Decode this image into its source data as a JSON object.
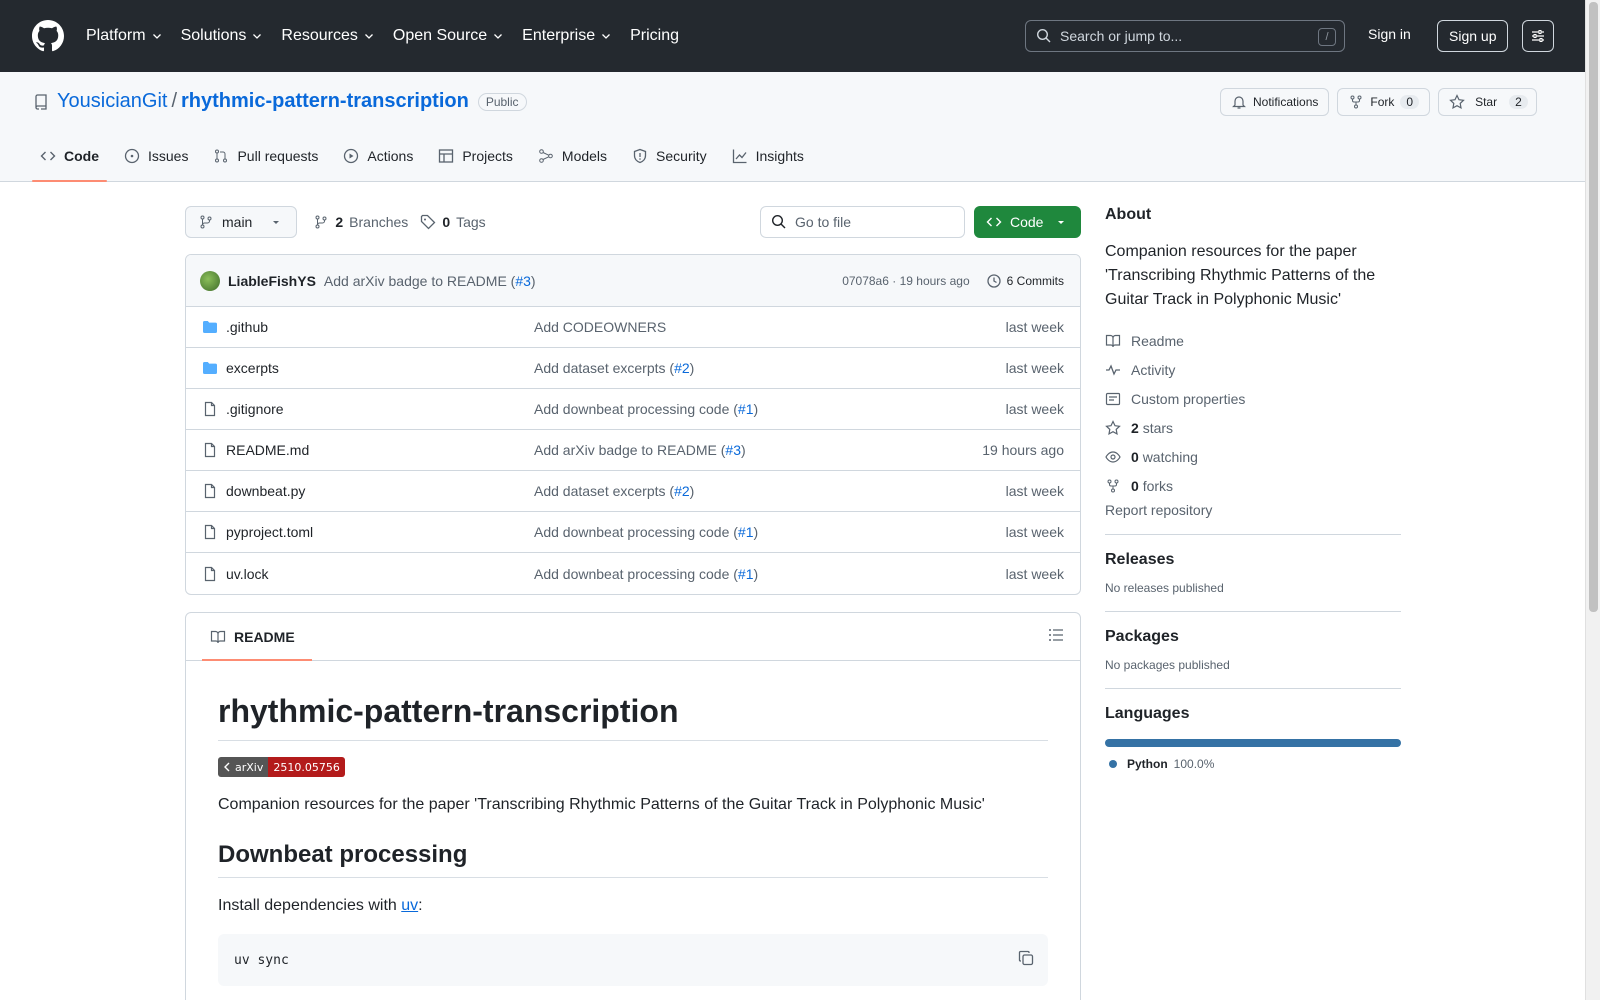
{
  "header": {
    "nav": [
      "Platform",
      "Solutions",
      "Resources",
      "Open Source",
      "Enterprise",
      "Pricing"
    ],
    "search_placeholder": "Search or jump to...",
    "search_shortcut": "/",
    "signin": "Sign in",
    "signup": "Sign up"
  },
  "repo": {
    "owner": "YousicianGit",
    "separator": "/",
    "name": "rhythmic-pattern-transcription",
    "visibility": "Public",
    "notifications_label": "Notifications",
    "fork_label": "Fork",
    "fork_count": "0",
    "star_label": "Star",
    "star_count": "2"
  },
  "tabs": [
    "Code",
    "Issues",
    "Pull requests",
    "Actions",
    "Projects",
    "Models",
    "Security",
    "Insights"
  ],
  "filebar": {
    "branch": "main",
    "branches_count": "2",
    "branches_label": "Branches",
    "tags_count": "0",
    "tags_label": "Tags",
    "goto_placeholder": "Go to file",
    "code_button": "Code"
  },
  "commit": {
    "author": "LiableFishYS",
    "message": "Add arXiv badge to README (",
    "pr": "#3",
    "message_end": ")",
    "hash": "07078a6",
    "dot": "·",
    "time": "19 hours ago",
    "commits": "6 Commits"
  },
  "files": [
    {
      "name": ".github",
      "type": "folder",
      "msg": "Add CODEOWNERS",
      "pr": "",
      "date": "last week"
    },
    {
      "name": "excerpts",
      "type": "folder",
      "msg": "Add dataset excerpts (",
      "pr": "#2",
      "date": "last week"
    },
    {
      "name": ".gitignore",
      "type": "file",
      "msg": "Add downbeat processing code (",
      "pr": "#1",
      "date": "last week"
    },
    {
      "name": "README.md",
      "type": "file",
      "msg": "Add arXiv badge to README (",
      "pr": "#3",
      "date": "19 hours ago"
    },
    {
      "name": "downbeat.py",
      "type": "file",
      "msg": "Add dataset excerpts (",
      "pr": "#2",
      "date": "last week"
    },
    {
      "name": "pyproject.toml",
      "type": "file",
      "msg": "Add downbeat processing code (",
      "pr": "#1",
      "date": "last week"
    },
    {
      "name": "uv.lock",
      "type": "file",
      "msg": "Add downbeat processing code (",
      "pr": "#1",
      "date": "last week"
    }
  ],
  "readme": {
    "tab_label": "README",
    "title": "rhythmic-pattern-transcription",
    "badge_left": "arXiv",
    "badge_right": "2510.05756",
    "description": "Companion resources for the paper 'Transcribing Rhythmic Patterns of the Guitar Track in Polyphonic Music'",
    "h2": "Downbeat processing",
    "install_text": "Install dependencies with ",
    "install_link": "uv",
    "install_end": ":",
    "code": "uv sync"
  },
  "about": {
    "title": "About",
    "description": "Companion resources for the paper 'Transcribing Rhythmic Patterns of the Guitar Track in Polyphonic Music'",
    "readme": "Readme",
    "activity": "Activity",
    "custom_properties": "Custom properties",
    "stars_count": "2",
    "stars_label": "stars",
    "watching_count": "0",
    "watching_label": "watching",
    "forks_count": "0",
    "forks_label": "forks",
    "report": "Report repository"
  },
  "releases": {
    "title": "Releases",
    "text": "No releases published"
  },
  "packages": {
    "title": "Packages",
    "text": "No packages published"
  },
  "languages": {
    "title": "Languages",
    "name": "Python",
    "percent": "100.0%",
    "fraction": 1.0,
    "color": "#3572a5"
  }
}
